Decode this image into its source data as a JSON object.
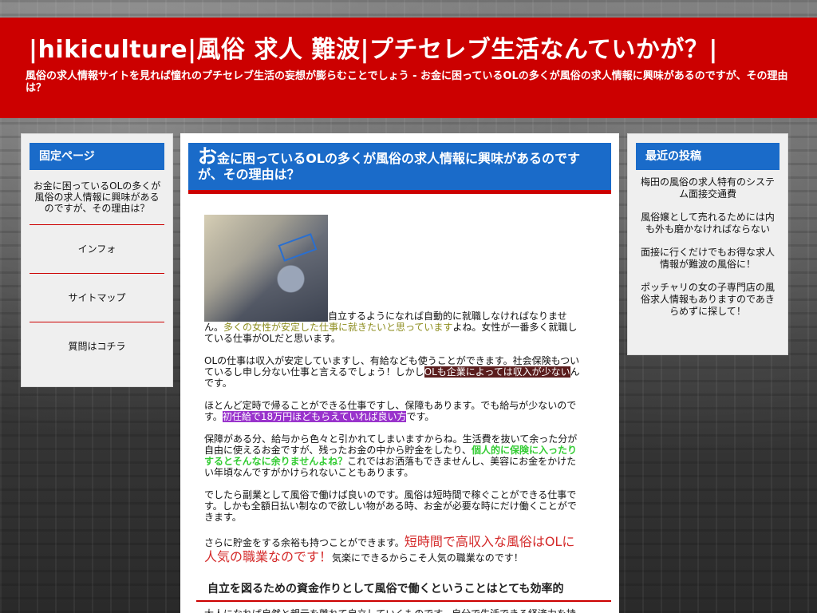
{
  "site": {
    "title": "|hikiculture|風俗 求人 難波|プチセレブ生活なんていかが？|",
    "description": "風俗の求人情報サイトを見れば憧れのプチセレブ生活の妄想が膨らむことでしょう - お金に困っているOLの多くが風俗の求人情報に興味があるのですが、その理由は？"
  },
  "left_sidebar": {
    "title": "固定ページ",
    "items": [
      "お金に困っているOLの多くが風俗の求人情報に興味があるのですが、その理由は？",
      "インフォ",
      "サイトマップ",
      "質問はコチラ"
    ]
  },
  "right_sidebar": {
    "title": "最近の投稿",
    "items": [
      "梅田の風俗の求人特有のシステム面接交通費",
      "風俗嬢として売れるためには内も外も磨かなければならない",
      "面接に行くだけでもお得な求人情報が難波の風俗に！",
      "ポッチャリの女の子専門店の風俗求人情報もありますのであきらめずに探して！"
    ]
  },
  "post": {
    "title_first": "お",
    "title_rest": "金に困っているOLの多くが風俗の求人情報に興味があるのですが、その理由は？",
    "p1_a": "自立するようになれば自動的に就職しなければなりません。",
    "p1_b": "多くの女性が安定した仕事に就きたいと思っています",
    "p1_c": "よね。女性が一番多く就職している仕事がOLだと思います。",
    "p2_a": "OLの仕事は収入が安定していますし、有給なども使うことができます。社会保険もついているし申し分ない仕事と言えるでしょう！しかし",
    "p2_b": "OLも企業によっては収入が少ない",
    "p2_c": "んです。",
    "p3_a": "ほとんど定時で帰ることができる仕事ですし、保障もあります。でも給与が少ないのです。",
    "p3_b": "初任給で18万円ほどもらえていれば良い方",
    "p3_c": "です。",
    "p4_a": "保障がある分、給与から色々と引かれてしまいますからね。生活費を抜いて余った分が自由に使えるお金ですが、残ったお金の中から貯金をしたり、",
    "p4_b": "個人的に保険に入ったりするとそんなに余りませんよね？",
    "p4_c": "これではお洒落もできませんし、美容にお金をかけたい年頃なんですがかけられないこともあります。",
    "p5": "でしたら副業として風俗で働けば良いのです。風俗は短時間で稼ぐことができる仕事です。しかも全額日払い制なので欲しい物がある時、お金が必要な時にだけ働くことができます。",
    "p6_a": "さらに貯金をする余裕も持つことができます。",
    "p6_b": "短時間で高収入な風俗はOLに人気の職業なのです！",
    "p6_c": "気楽にできるからこそ人気の職業なのです！",
    "section_heading": "自立を図るための資金作りとして風俗で働くということはとても効率的",
    "cut_text": "大人になれば自然と親元を離れて自立していくものです。自分で生活できる経済力を持"
  }
}
